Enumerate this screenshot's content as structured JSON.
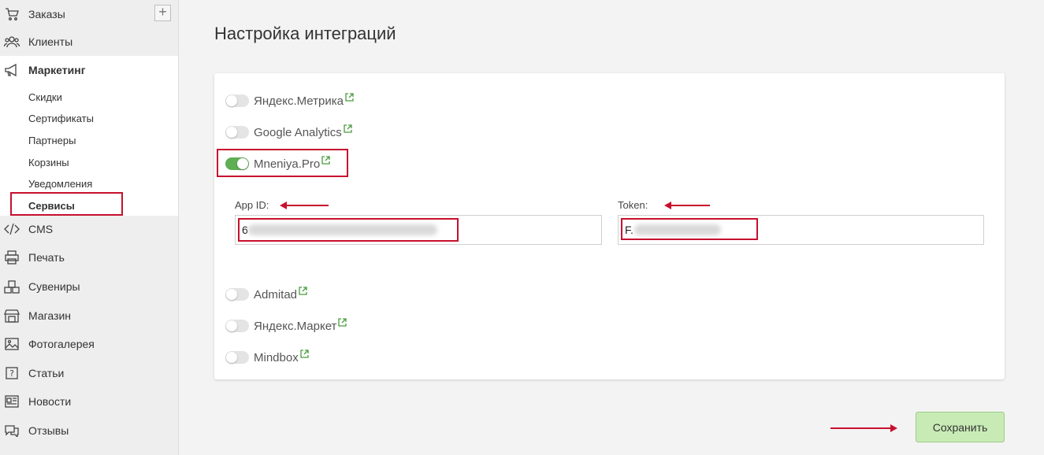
{
  "sidebar": {
    "items": [
      {
        "label": "Заказы",
        "icon": "cart-icon"
      },
      {
        "label": "Клиенты",
        "icon": "users-icon"
      },
      {
        "label": "Маркетинг",
        "icon": "megaphone-icon"
      },
      {
        "label": "CMS",
        "icon": "code-icon"
      },
      {
        "label": "Печать",
        "icon": "printer-icon"
      },
      {
        "label": "Сувениры",
        "icon": "boxes-icon"
      },
      {
        "label": "Магазин",
        "icon": "store-icon"
      },
      {
        "label": "Фотогалерея",
        "icon": "image-icon"
      },
      {
        "label": "Статьи",
        "icon": "question-icon"
      },
      {
        "label": "Новости",
        "icon": "newspaper-icon"
      },
      {
        "label": "Отзывы",
        "icon": "chat-icon"
      }
    ],
    "marketing_sub": [
      "Скидки",
      "Сертификаты",
      "Партнеры",
      "Корзины",
      "Уведомления",
      "Сервисы"
    ],
    "plus_label": "+"
  },
  "main": {
    "title": "Настройка интеграций",
    "services": [
      {
        "name": "Яндекс.Метрика",
        "enabled": false
      },
      {
        "name": "Google Analytics",
        "enabled": false
      },
      {
        "name": "Mneniya.Pro",
        "enabled": true
      },
      {
        "name": "Admitad",
        "enabled": false
      },
      {
        "name": "Яндекс.Маркет",
        "enabled": false
      },
      {
        "name": "Mindbox",
        "enabled": false
      }
    ],
    "app_id_label": "App ID:",
    "app_id_value": "6",
    "token_label": "Token:",
    "token_value": "F.",
    "save_label": "Сохранить"
  },
  "colors": {
    "accent_green": "#5fae55",
    "save_button_bg": "#c8ebb6",
    "highlight_red": "#c8102e"
  }
}
